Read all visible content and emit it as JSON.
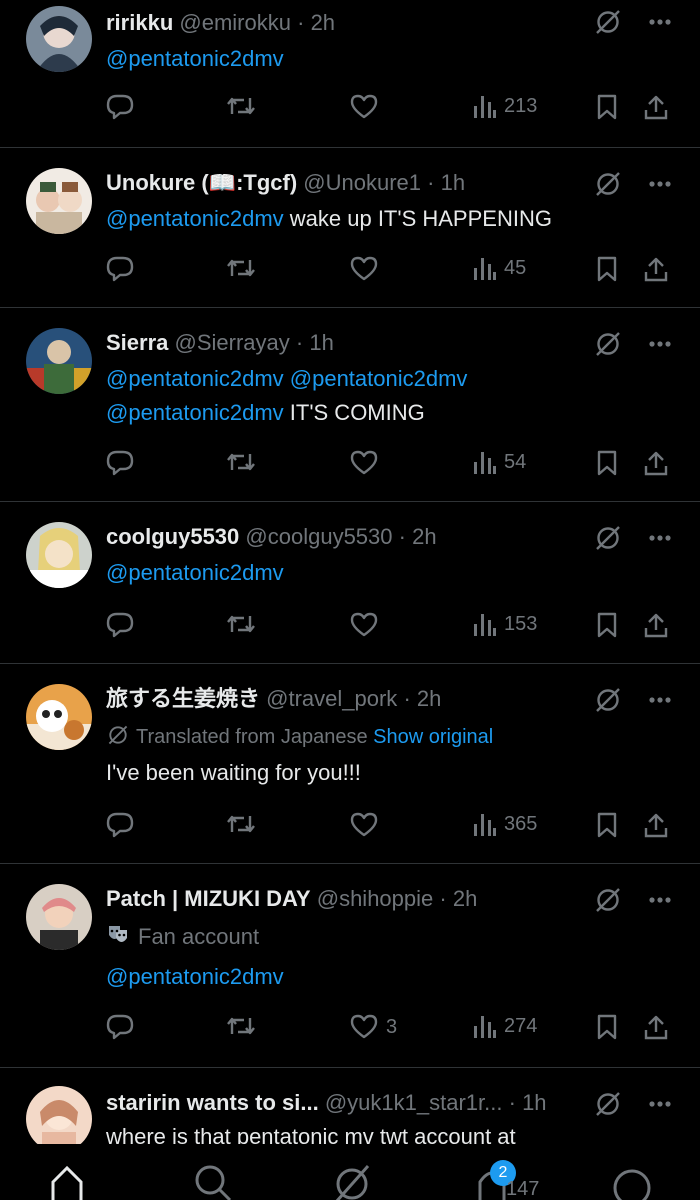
{
  "colors": {
    "background": "#000000",
    "text": "#e7e9ea",
    "muted": "#71767b",
    "accent": "#1d9bf0",
    "divider": "#2f3336"
  },
  "posts": [
    {
      "name": "ririkku",
      "handle": "@emirokku",
      "sep": "·",
      "time": "2h",
      "lines": [
        {
          "mention": "@pentatonic2dmv",
          "text": ""
        }
      ],
      "views": "213",
      "likes": ""
    },
    {
      "name": "Unokure (📖:Tgcf)",
      "handle": "@Unokure1",
      "sep": "·",
      "time": "1h",
      "lines": [
        {
          "mention": "@pentatonic2dmv",
          "text": " wake up IT'S HAPPENING"
        }
      ],
      "views": "45",
      "likes": ""
    },
    {
      "name": "Sierra",
      "handle": "@Sierrayay",
      "sep": "·",
      "time": "1h",
      "lines": [
        {
          "mention": "@pentatonic2dmv @pentatonic2dmv",
          "text": ""
        },
        {
          "mention": "@pentatonic2dmv",
          "text": " IT'S COMING"
        }
      ],
      "views": "54",
      "likes": ""
    },
    {
      "name": "coolguy5530",
      "handle": "@coolguy5530",
      "sep": "·",
      "time": "2h",
      "lines": [
        {
          "mention": "@pentatonic2dmv",
          "text": ""
        }
      ],
      "views": "153",
      "likes": ""
    },
    {
      "name": "旅する生姜焼き",
      "handle": "@travel_pork",
      "sep": "·",
      "time": "2h",
      "translated": "Translated from Japanese",
      "show_original": "Show original",
      "lines": [
        {
          "mention": "",
          "text": "I've been waiting for you!!!"
        }
      ],
      "views": "365",
      "likes": ""
    },
    {
      "name": "Patch | MIZUKI DAY",
      "handle": "@shihoppie",
      "sep": "·",
      "time": "2h",
      "fan_label": "Fan account",
      "lines": [
        {
          "mention": "@pentatonic2dmv",
          "text": ""
        }
      ],
      "views": "274",
      "likes": "3"
    },
    {
      "name": "staririn wants to si...",
      "handle": "@yuk1k1_star1r...",
      "sep": "·",
      "time": "1h",
      "lines": [
        {
          "mention": "",
          "text": "where is that pentatonic mv twt account at"
        }
      ],
      "views": "",
      "likes": ""
    }
  ],
  "tabbar": {
    "notifications_badge": "2",
    "partial_count": "147"
  },
  "icons": {
    "reply": "reply-icon",
    "repost": "repost-icon",
    "like": "heart-icon",
    "views": "views-icon",
    "bookmark": "bookmark-icon",
    "share": "share-icon",
    "grok": "grok-icon",
    "more": "more-icon",
    "translate": "translate-icon",
    "fan": "theater-mask-icon"
  }
}
